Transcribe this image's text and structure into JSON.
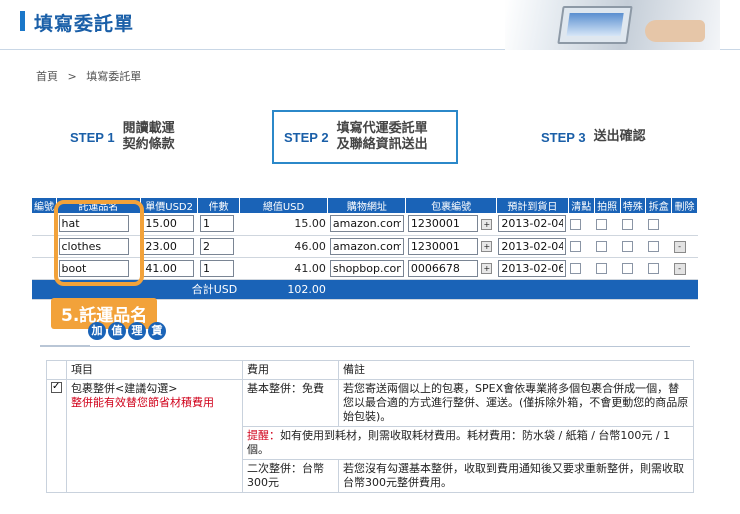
{
  "header": {
    "title": "填寫委託單"
  },
  "breadcrumb": {
    "home": "首頁",
    "sep": ">",
    "current": "填寫委託單"
  },
  "steps": [
    {
      "no": "STEP 1",
      "line1": "閱讀載運",
      "line2": "契約條款"
    },
    {
      "no": "STEP 2",
      "line1": "填寫代運委託單",
      "line2": "及聯絡資訊送出"
    },
    {
      "no": "STEP 3",
      "line1": "送出確認",
      "line2": ""
    }
  ],
  "table": {
    "headers": [
      "編號",
      "託運品名",
      "單價USD2",
      "件數",
      "總值USD",
      "購物網址",
      "包裹編號",
      "預計到貨日",
      "清點",
      "拍照",
      "特殊",
      "拆盒",
      "刪除"
    ],
    "rows": [
      {
        "name": "hat",
        "price": "15.00",
        "qty": "1",
        "total": "15.00",
        "url": "amazon.com",
        "pkg": "1230001",
        "date": "2013-02-04"
      },
      {
        "name": "clothes",
        "price": "23.00",
        "qty": "2",
        "total": "46.00",
        "url": "amazon.com",
        "pkg": "1230001",
        "date": "2013-02-04"
      },
      {
        "name": "boot",
        "price": "41.00",
        "qty": "1",
        "total": "41.00",
        "url": "shopbop.com",
        "pkg": "0006678",
        "date": "2013-02-06"
      }
    ],
    "sum_label": "合計USD",
    "sum_value": "102.00"
  },
  "highlight": {
    "label": "5.託運品名"
  },
  "vas": {
    "title_chars": [
      "加",
      "值",
      "理",
      "賃"
    ],
    "headers": {
      "item": "項目",
      "fee": "費用",
      "note": "備註"
    },
    "service": {
      "name": "包裹整併<建議勾選>",
      "desc": "整併能有效替您節省材積費用"
    },
    "rows": [
      {
        "fee": "基本整併：免費",
        "note": "若您寄送兩個以上的包裹，SPEX會依專業將多個包裹合併成一個，替您以最合適的方式進行整併、運送。(僅拆除外箱，不會更動您的商品原始包裝)。"
      },
      {
        "reminder": "提醒：",
        "reminder_text": "如有使用到耗材，則需收取耗材費用。耗材費用：防水袋 / 紙箱 / 台幣100元 / 1個。"
      },
      {
        "fee": "二次整併：台幣300元",
        "note": "若您沒有勾選基本整併，收取到費用通知後又要求重新整併，則需收取台幣300元整併費用。"
      }
    ]
  }
}
